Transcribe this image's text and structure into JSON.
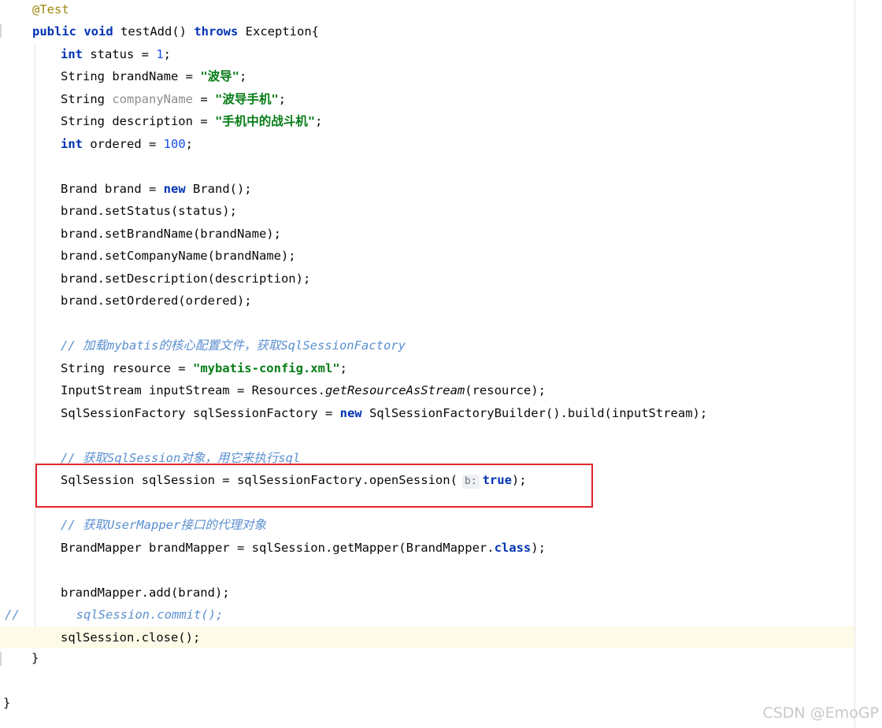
{
  "code": {
    "annotation": "@Test",
    "method": {
      "kw_public": "public",
      "kw_void": "void",
      "name": " testAdd() ",
      "kw_throws": "throws",
      "tail": " Exception{"
    },
    "status": {
      "kw": "int",
      "mid": " status = ",
      "num": "1",
      "end": ";"
    },
    "brandName": {
      "pre": "String brandName = ",
      "str": "\"波导\"",
      "end": ";"
    },
    "companyName": {
      "pre": "String ",
      "var": "companyName",
      "mid": " = ",
      "str": "\"波导手机\"",
      "end": ";"
    },
    "description": {
      "pre": "String description = ",
      "str": "\"手机中的战斗机\"",
      "end": ";"
    },
    "ordered": {
      "kw": "int",
      "mid": " ordered = ",
      "num": "100",
      "end": ";"
    },
    "brandNew": {
      "pre": "Brand brand = ",
      "kw": "new",
      "post": " Brand();"
    },
    "setStatus": "brand.setStatus(status);",
    "setBrandName": "brand.setBrandName(brandName);",
    "setCompanyName": "brand.setCompanyName(brandName);",
    "setDescription": "brand.setDescription(description);",
    "setOrdered": "brand.setOrdered(ordered);",
    "comment1": "// 加载mybatis的核心配置文件，获取SqlSessionFactory",
    "resource": {
      "pre": "String resource = ",
      "str": "\"mybatis-config.xml\"",
      "end": ";"
    },
    "inputStream": {
      "pre": "InputStream inputStream = Resources.",
      "method": "getResourceAsStream",
      "post": "(resource);"
    },
    "factory": {
      "pre": "SqlSessionFactory sqlSessionFactory = ",
      "kw": "new",
      "post": " SqlSessionFactoryBuilder().build(inputStream);"
    },
    "comment2": "// 获取SqlSession对象，用它来执行sql",
    "openSession": {
      "pre": "SqlSession sqlSession = sqlSessionFactory.openSession(",
      "hint": "b:",
      "kw": "true",
      "end": ");"
    },
    "comment3": "// 获取UserMapper接口的代理对象",
    "mapper": {
      "pre": "BrandMapper brandMapper = sqlSession.getMapper(BrandMapper.",
      "kw": "class",
      "end": ");"
    },
    "add": "brandMapper.add(brand);",
    "commented": {
      "slashes": "//",
      "code": "sqlSession.commit();"
    },
    "close": "sqlSession.close();",
    "brace_method": "}",
    "brace_class": "}"
  },
  "watermark": "CSDN @EmoGP"
}
